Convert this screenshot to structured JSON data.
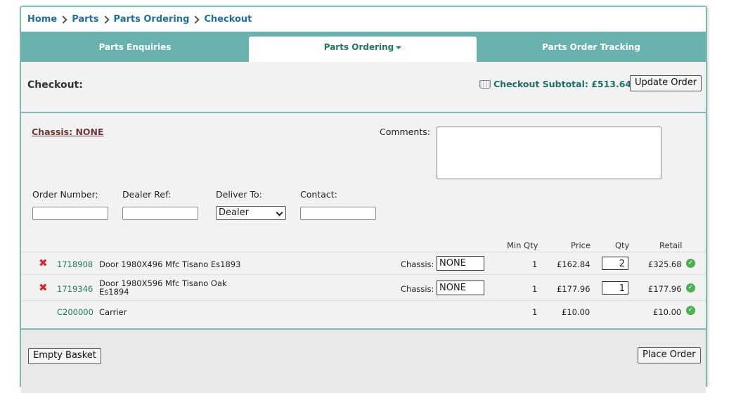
{
  "breadcrumb": [
    "Home",
    "Parts",
    "Parts Ordering",
    "Checkout"
  ],
  "tabs": {
    "enquiries": "Parts Enquiries",
    "ordering": "Parts Ordering",
    "tracking": "Parts Order Tracking"
  },
  "checkout": {
    "title": "Checkout:",
    "subtotal": "Checkout Subtotal: £513.64",
    "update_label": "Update Order"
  },
  "form": {
    "chassis_link": "Chassis: NONE",
    "comments_label": "Comments:",
    "comments_value": "",
    "order_number_label": "Order Number:",
    "order_number_value": "",
    "dealer_ref_label": "Dealer Ref:",
    "dealer_ref_value": "",
    "deliver_to_label": "Deliver To:",
    "deliver_to_value": "Dealer",
    "contact_label": "Contact:",
    "contact_value": ""
  },
  "table": {
    "headers": {
      "min_qty": "Min Qty",
      "price": "Price",
      "qty": "Qty",
      "retail": "Retail"
    },
    "rows": [
      {
        "part_number": "1718908",
        "description": "Door 1980X496 Mfc Tisano Es1893",
        "chassis_label": "Chassis:",
        "chassis_value": "NONE",
        "min_qty": "1",
        "price": "£162.84",
        "qty": "2",
        "retail": "£325.68"
      },
      {
        "part_number": "1719346",
        "description": "Door 1980X596 Mfc Tisano Oak Es1894",
        "chassis_label": "Chassis:",
        "chassis_value": "NONE",
        "min_qty": "1",
        "price": "£177.96",
        "qty": "1",
        "retail": "£177.96"
      },
      {
        "part_number": "C200000",
        "description": "Carrier",
        "min_qty": "1",
        "price": "£10.00",
        "retail": "£10.00"
      }
    ]
  },
  "footer": {
    "empty_label": "Empty Basket",
    "place_label": "Place Order"
  },
  "icons": {
    "remove": "close-icon",
    "ok": "check-circle-icon",
    "basket": "basket-icon",
    "crumb_sep": "chevron-right-icon"
  },
  "colors": {
    "accent": "#69b2ae",
    "link": "#1f6fa0",
    "part_number": "#1f7a5a",
    "remove": "#d42a2a",
    "ok": "#4caf50"
  }
}
